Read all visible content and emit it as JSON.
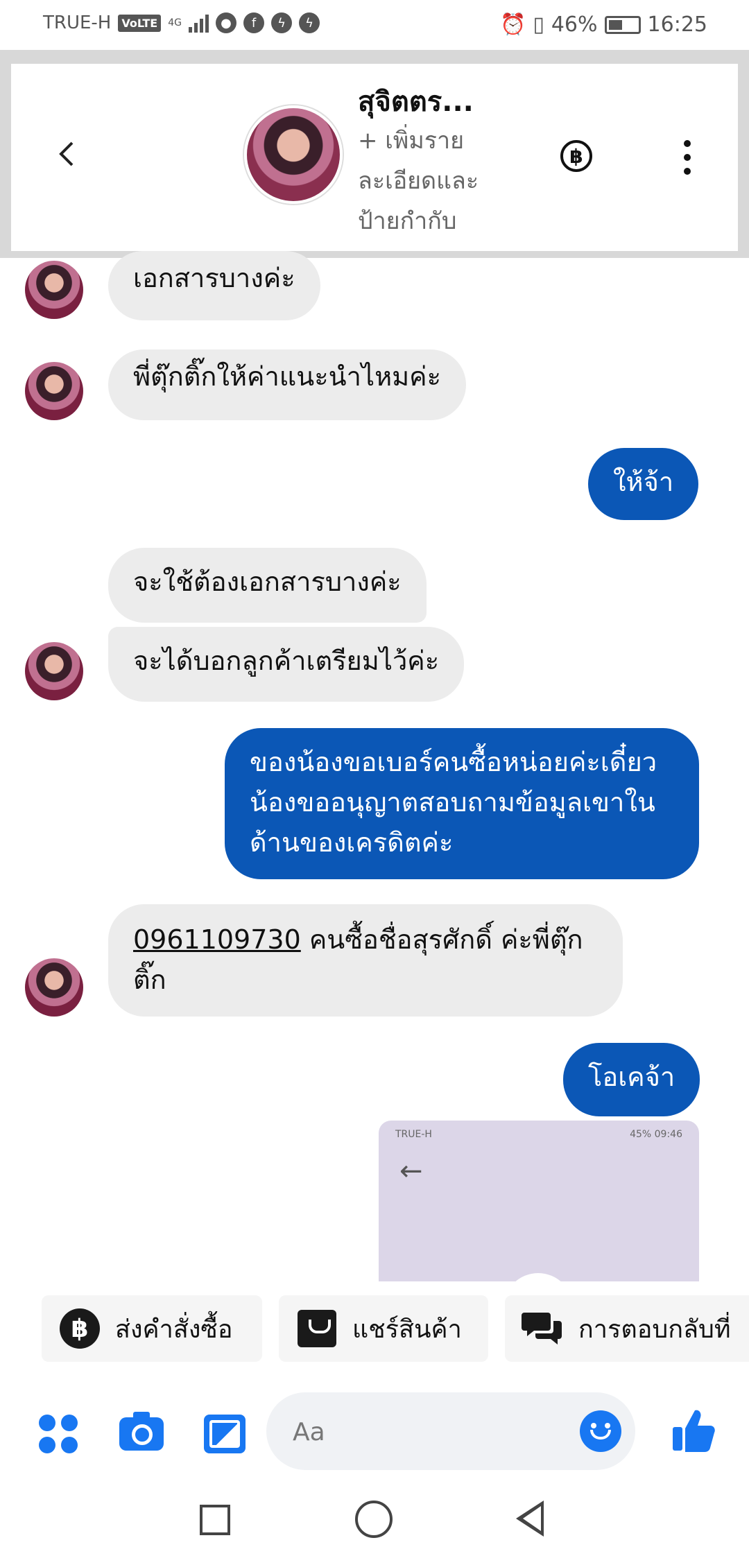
{
  "status_bar": {
    "carrier": "TRUE-H",
    "volte": "VoLTE",
    "network": "4G",
    "battery": "46%",
    "time": "16:25",
    "icons": [
      "line-icon",
      "facebook-icon",
      "messenger-icon",
      "messenger-icon"
    ]
  },
  "header": {
    "name": "สุจิตตร...",
    "subtitle": "+ เพิ่มรายละเอียดและป้ายกำกับ",
    "baht_symbol": "฿"
  },
  "messages": [
    {
      "side": "in",
      "text": "เอกสารบางค่ะ"
    },
    {
      "side": "in",
      "text": "พี่ตุ๊กติ๊กให้ค่าแนะนำไหมค่ะ"
    },
    {
      "side": "out",
      "text": "ให้จ้า"
    },
    {
      "side": "in",
      "text": "จะใช้ต้องเอกสารบางค่ะ"
    },
    {
      "side": "in",
      "text": "จะได้บอกลูกค้าเตรียมไว้ค่ะ"
    },
    {
      "side": "out",
      "text": "ของน้องขอเบอร์คนซื้อหน่อยค่ะเดี๋ยวน้องขออนุญาตสอบถามข้อมูลเขาในด้านของเครดิตค่ะ"
    },
    {
      "side": "in",
      "phone": "0961109730",
      "text": " คนซื้อชื่อสุรศักดิ์ ค่ะพี่ตุ๊กติ๊ก"
    },
    {
      "side": "out",
      "text": "โอเคจ้า"
    }
  ],
  "image_preview": {
    "carrier": "TRUE-H",
    "battery": "45%",
    "time": "09:46"
  },
  "quick_actions": [
    {
      "label": "ส่งคำสั่งซื้อ",
      "icon": "baht-icon"
    },
    {
      "label": "แชร์สินค้า",
      "icon": "shopping-bag-icon"
    },
    {
      "label": "การตอบกลับที่",
      "icon": "chat-bubbles-icon"
    }
  ],
  "composer": {
    "placeholder": "Aa"
  },
  "colors": {
    "outgoing_bubble": "#0b57b6",
    "incoming_bubble": "#ececec",
    "accent": "#1877f2"
  }
}
